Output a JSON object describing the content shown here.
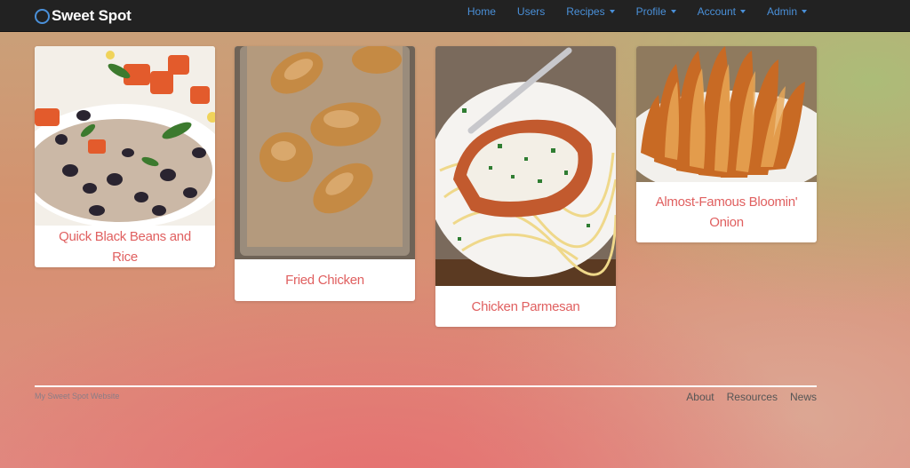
{
  "navbar": {
    "brand": "Sweet Spot",
    "links": [
      {
        "label": "Home",
        "dropdown": false
      },
      {
        "label": "Users",
        "dropdown": false
      },
      {
        "label": "Recipes",
        "dropdown": true
      },
      {
        "label": "Profile",
        "dropdown": true
      },
      {
        "label": "Account",
        "dropdown": true
      },
      {
        "label": "Admin",
        "dropdown": true
      }
    ]
  },
  "recipes": [
    {
      "title": "Quick Black Beans and Rice"
    },
    {
      "title": "Fried Chicken"
    },
    {
      "title": "Chicken Parmesan"
    },
    {
      "title": "Almost-Famous Bloomin' Onion"
    }
  ],
  "footer": {
    "brand": "My Sweet Spot Website",
    "links": [
      "About",
      "Resources",
      "News"
    ]
  },
  "colors": {
    "navbar": "#222222",
    "nav_link": "#4a90d9",
    "card_title": "#e06060"
  }
}
